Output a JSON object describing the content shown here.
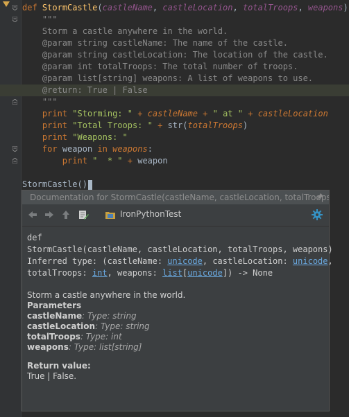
{
  "code": {
    "def_kw": "def",
    "func_name": "StormCastle",
    "params": [
      "castleName",
      "castleLocation",
      "totalTroops",
      "weapons"
    ],
    "doc_open": "\"\"\"",
    "doc_summary": "Storm a castle anywhere in the world.",
    "doc_param1": "@param string castleName: The name of the castle.",
    "doc_param2": "@param string castleLocation: The location of the castle.",
    "doc_param3": "@param int totalTroops: The total number of troops.",
    "doc_param4": "@param list[string] weapons: A list of weapons to use.",
    "doc_return": "@return: True | False",
    "doc_close": "\"\"\"",
    "print_kw": "print",
    "str1": "\"Storming: \"",
    "str_at": "\" at \"",
    "str2": "\"Total Troops: \"",
    "str_fn": "str",
    "str3": "\"Weapons: \"",
    "for_kw": "for",
    "loop_var": "weapon",
    "in_kw": "in",
    "str4": "\"  * \"",
    "call_name": "StormCastle("
  },
  "doc_popup": {
    "title": "Documentation for StormCastle(castleName, castleLocation, totalTroops, w...",
    "module_label": "IronPythonTest",
    "sig_def": "def",
    "sig_line": "StormCastle(castleName, castleLocation, totalTroops, weapons)",
    "inferred_prefix": "Inferred type: (castleName: ",
    "unicode": "unicode",
    "inferred_mid": ", castleLocation: ",
    "comma": ",",
    "troops_prefix": "totalTroops: ",
    "int_type": "int",
    "weapons_prefix": ", weapons: ",
    "list_type": "list",
    "lb": "[",
    "rb_tail": "]) -> None",
    "summary": "Storm a castle anywhere in the world.",
    "parameters_heading": "Parameters",
    "param_rows": [
      {
        "name": "castleName",
        "type": ": Type: string"
      },
      {
        "name": "castleLocation",
        "type": ": Type: string"
      },
      {
        "name": "totalTroops",
        "type": ": Type: int"
      },
      {
        "name": "weapons",
        "type": ": Type: list[string]"
      }
    ],
    "return_heading": "Return value:",
    "return_text": "True | False."
  },
  "colors": {
    "background": "#2b2b2b",
    "keyword": "#cc7832",
    "function": "#ffc66d",
    "string": "#a5c261",
    "parameter": "#94558d",
    "docstring": "#629755",
    "link": "#6aa9e0",
    "gear": "#3592c4"
  },
  "icons": {
    "back": "back-arrow-icon",
    "forward": "forward-arrow-icon",
    "up": "up-arrow-icon",
    "edit_source": "edit-source-icon",
    "module": "module-folder-icon",
    "settings": "gear-icon",
    "pin": "pin-icon"
  }
}
